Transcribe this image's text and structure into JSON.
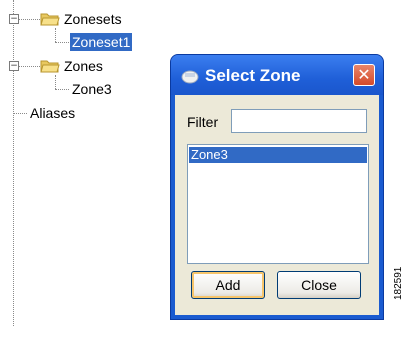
{
  "tree": {
    "items": [
      {
        "label": "Zonesets"
      },
      {
        "label": "Zoneset1"
      },
      {
        "label": "Zones"
      },
      {
        "label": "Zone3"
      },
      {
        "label": "Aliases"
      }
    ]
  },
  "dialog": {
    "title": "Select Zone",
    "filter_label": "Filter",
    "filter_value": "",
    "zones": [
      "Zone3"
    ],
    "add_label": "Add",
    "close_label": "Close"
  },
  "figure_number": "182591",
  "colors": {
    "selection": "#316ac5",
    "titlebar": "#1f5fd8",
    "close_button": "#d54a2a"
  }
}
